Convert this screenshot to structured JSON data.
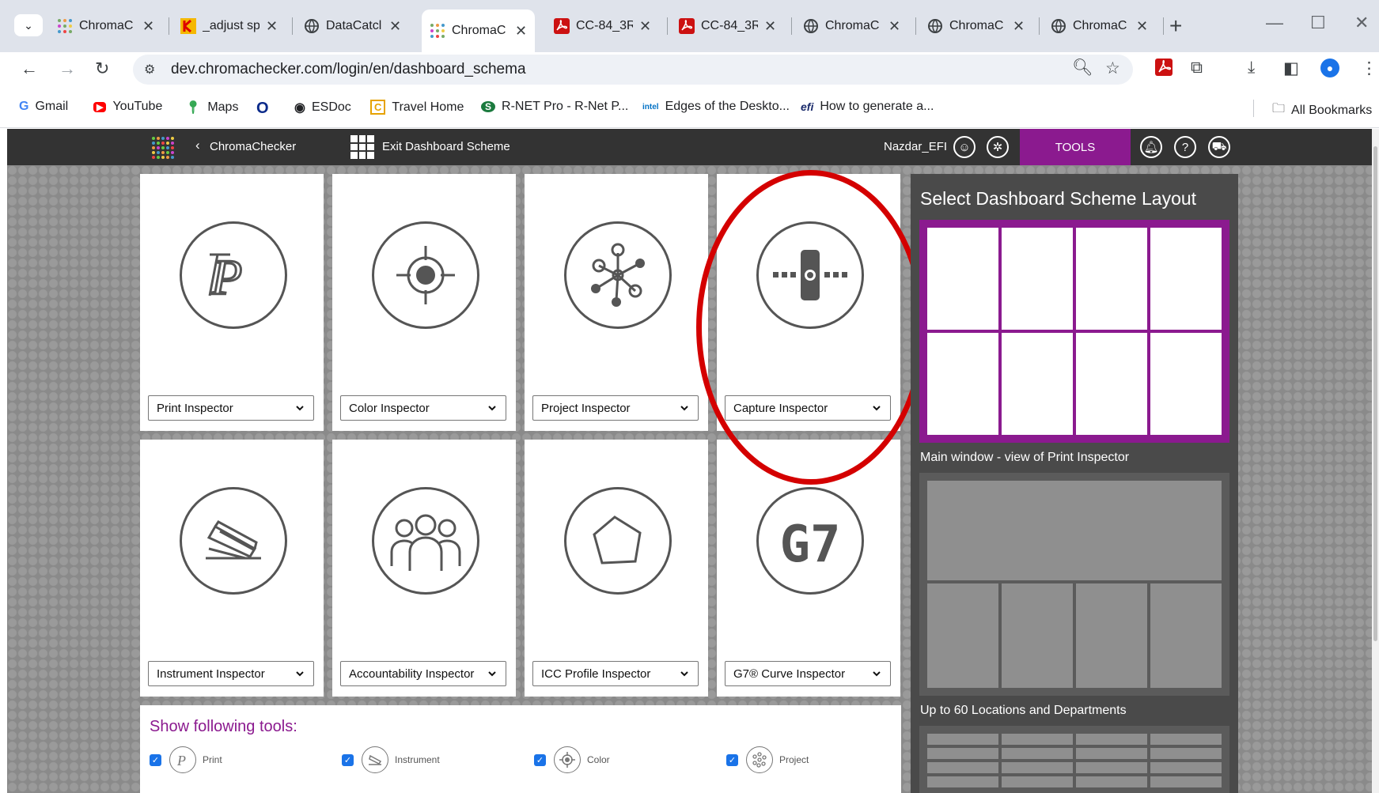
{
  "browser": {
    "tabs": [
      {
        "label": "ChromaC",
        "favicon": "chromachecker-grid-icon"
      },
      {
        "label": "_adjust sp",
        "favicon": "kodak-icon"
      },
      {
        "label": "DataCatcl",
        "favicon": "globe-icon"
      },
      {
        "label": "ChromaC",
        "favicon": "chromachecker-grid-icon",
        "active": true
      },
      {
        "label": "CC-84_3R",
        "favicon": "pdf-icon"
      },
      {
        "label": "CC-84_3R",
        "favicon": "pdf-icon"
      },
      {
        "label": "ChromaC",
        "favicon": "globe-icon"
      },
      {
        "label": "ChromaC",
        "favicon": "globe-icon"
      },
      {
        "label": "ChromaC",
        "favicon": "globe-icon"
      }
    ],
    "new_tab": "+",
    "url": "dev.chromachecker.com/login/en/dashboard_schema",
    "bookmarks": [
      {
        "label": "Gmail",
        "icon": "G"
      },
      {
        "label": "YouTube",
        "icon": "▶"
      },
      {
        "label": "Maps",
        "icon": "⬤"
      },
      {
        "label": "",
        "icon": "O"
      },
      {
        "label": "ESDoc",
        "icon": "◉"
      },
      {
        "label": "Travel Home",
        "icon": "C"
      },
      {
        "label": "R-NET Pro - R-Net P...",
        "icon": "S"
      },
      {
        "label": "Edges of the Deskto...",
        "icon": "intel"
      },
      {
        "label": "How to generate a...",
        "icon": "efi"
      }
    ],
    "all_bookmarks": "All Bookmarks"
  },
  "app": {
    "back_label": "ChromaChecker",
    "exit_label": "Exit Dashboard Scheme",
    "user": "Nazdar_EFI",
    "tools_label": "TOOLS"
  },
  "cards": [
    {
      "label": "Print Inspector",
      "icon": "print-inspector-icon"
    },
    {
      "label": "Color Inspector",
      "icon": "color-inspector-icon"
    },
    {
      "label": "Project Inspector",
      "icon": "project-inspector-icon"
    },
    {
      "label": "Capture Inspector",
      "icon": "capture-inspector-icon"
    },
    {
      "label": "Instrument Inspector",
      "icon": "instrument-inspector-icon"
    },
    {
      "label": "Accountability Inspector",
      "icon": "accountability-inspector-icon"
    },
    {
      "label": "ICC Profile Inspector",
      "icon": "icc-profile-inspector-icon"
    },
    {
      "label": "G7® Curve Inspector",
      "icon": "g7-curve-inspector-icon"
    }
  ],
  "layout_panel": {
    "title": "Select Dashboard Scheme Layout",
    "caption_1": "Main window - view of Print Inspector",
    "caption_2": "Up to 60 Locations and Departments"
  },
  "tools_panel": {
    "title": "Show following tools:",
    "items": [
      {
        "label": "Print",
        "checked": true
      },
      {
        "label": "Instrument",
        "checked": true
      },
      {
        "label": "Color",
        "checked": true
      },
      {
        "label": "Project",
        "checked": true
      }
    ]
  },
  "colors": {
    "accent": "#8b1a8f",
    "highlight": "#d40000",
    "header": "#333333"
  }
}
